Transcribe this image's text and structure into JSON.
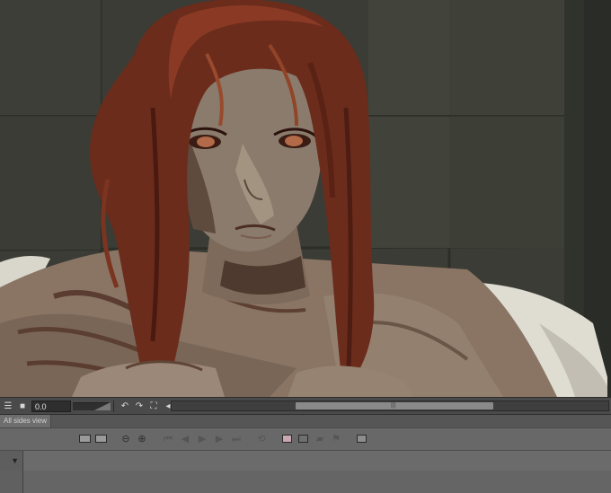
{
  "canvas": {
    "artwork": "painted-portrait",
    "zoom_label": "0.0"
  },
  "statusbar": {
    "icons": [
      "menu-icon",
      "stop-icon",
      "rotate-left-icon",
      "rotate-right-icon",
      "fit-icon",
      "arrow-left-icon"
    ],
    "scroll_grip": "|||"
  },
  "timeline": {
    "tab_label": "All sides view",
    "dropdown_icon": "chevron-down-icon",
    "toolbar_icons": [
      "add-cel-icon",
      "delete-cel-icon",
      "zoom-out-icon",
      "zoom-in-icon",
      "first-frame-icon",
      "prev-frame-icon",
      "play-icon",
      "next-frame-icon",
      "last-frame-icon",
      "loop-icon",
      "onion-skin-icon",
      "frame-icon",
      "keyframe-icon",
      "flag-icon",
      "settings-icon"
    ]
  },
  "colors": {
    "panel_bg": "#636363",
    "statusbar_bg": "#4a4a4a",
    "hair": "#6b2c1c",
    "skin": "#8c7868",
    "wall": "#3b3d36"
  }
}
